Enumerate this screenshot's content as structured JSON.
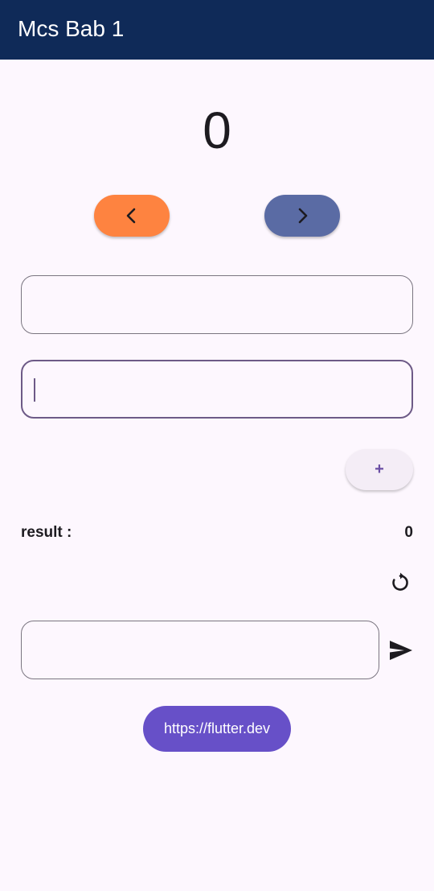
{
  "appbar": {
    "title": "Mcs Bab 1",
    "background": "#0f2a58"
  },
  "counter": {
    "value": "0"
  },
  "nav_buttons": {
    "prev": {
      "icon": "chevron-left-icon",
      "color": "#fe8340"
    },
    "next": {
      "icon": "chevron-right-icon",
      "color": "#5a6ba4"
    }
  },
  "inputs": {
    "first": {
      "value": "",
      "placeholder": ""
    },
    "second": {
      "value": "",
      "placeholder": "",
      "focused": true
    }
  },
  "add_button": {
    "label": "+"
  },
  "result": {
    "label": "result :",
    "value": "0"
  },
  "reset": {
    "icon": "refresh-icon"
  },
  "message": {
    "input_value": "",
    "input_placeholder": "",
    "send_icon": "send-icon"
  },
  "link_button": {
    "label": "https://flutter.dev",
    "color": "#6750c8"
  }
}
